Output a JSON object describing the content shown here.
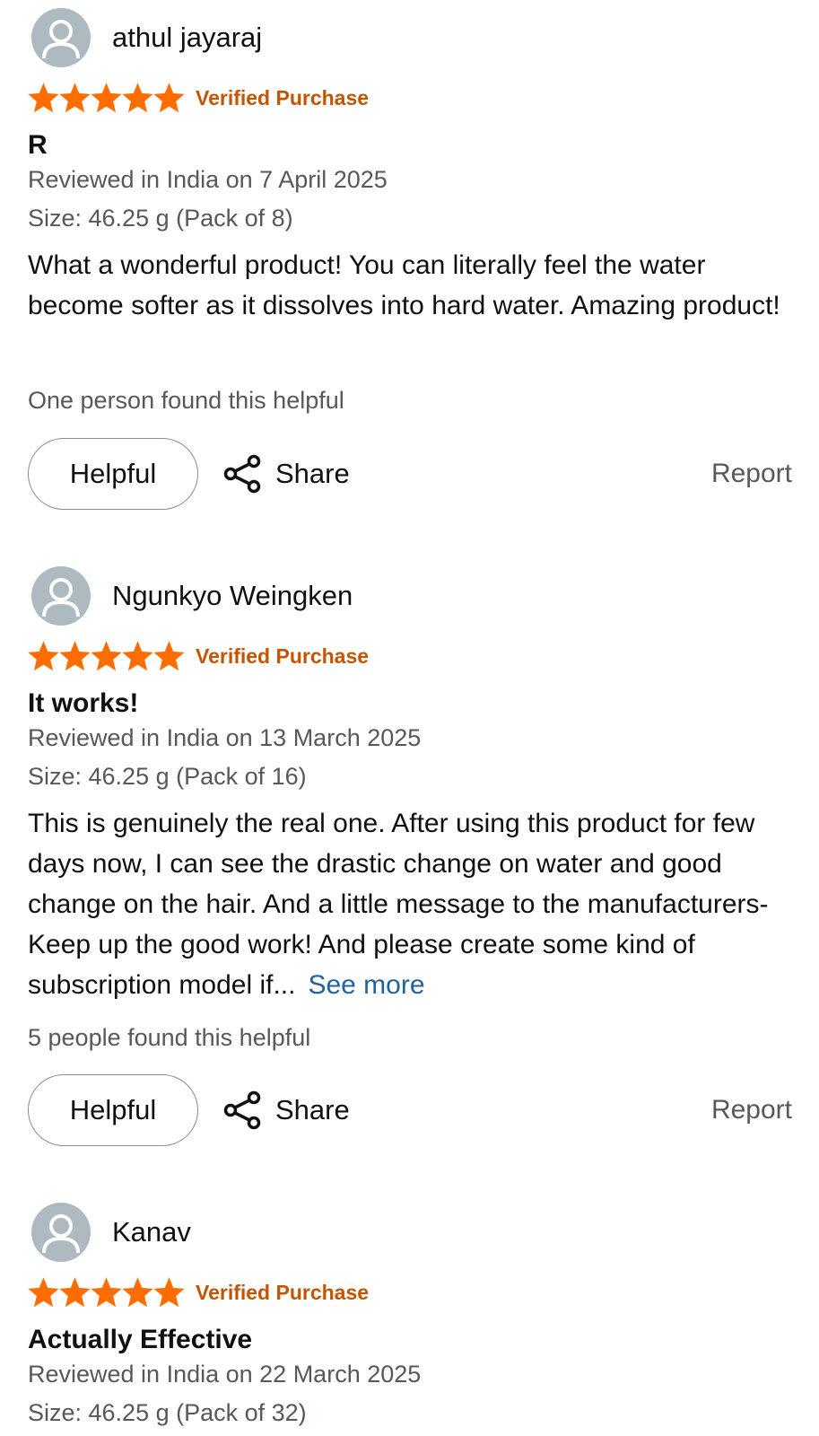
{
  "reviews": [
    {
      "author": "athul jayaraj",
      "verified_label": "Verified Purchase",
      "stars": 5,
      "title": "R",
      "reviewed_line": "Reviewed in India on 7 April 2025",
      "size_line": "Size: 46.25 g (Pack of 8)",
      "body": "What a wonderful product! You can literally feel the water become softer as it dissolves into hard water. Amazing product!",
      "see_more": "",
      "helpful_count": "One person found this helpful",
      "helpful_label": "Helpful",
      "share_label": "Share",
      "report_label": "Report"
    },
    {
      "author": "Ngunkyo Weingken",
      "verified_label": "Verified Purchase",
      "stars": 5,
      "title": "It works!",
      "reviewed_line": "Reviewed in India on 13 March 2025",
      "size_line": "Size: 46.25 g (Pack of 16)",
      "body": "This is genuinely the real one. After using this product for few days now, I can see the drastic change on water and good change on the hair. And a little message to the manufacturers- Keep up the good work! And please create some kind of subscription model if...",
      "see_more": "See more",
      "helpful_count": "5 people found this helpful",
      "helpful_label": "Helpful",
      "share_label": "Share",
      "report_label": "Report"
    },
    {
      "author": "Kanav",
      "verified_label": "Verified Purchase",
      "stars": 5,
      "title": "Actually Effective",
      "reviewed_line": "Reviewed in India on 22 March 2025",
      "size_line": "Size: 46.25 g (Pack of 32)"
    }
  ],
  "icons": {
    "avatar": "user-avatar-icon",
    "star": "star-icon",
    "share": "share-icon"
  },
  "colors": {
    "star": "#ff6d00",
    "verified": "#c45500",
    "link": "#2162a1",
    "muted": "#565959"
  }
}
